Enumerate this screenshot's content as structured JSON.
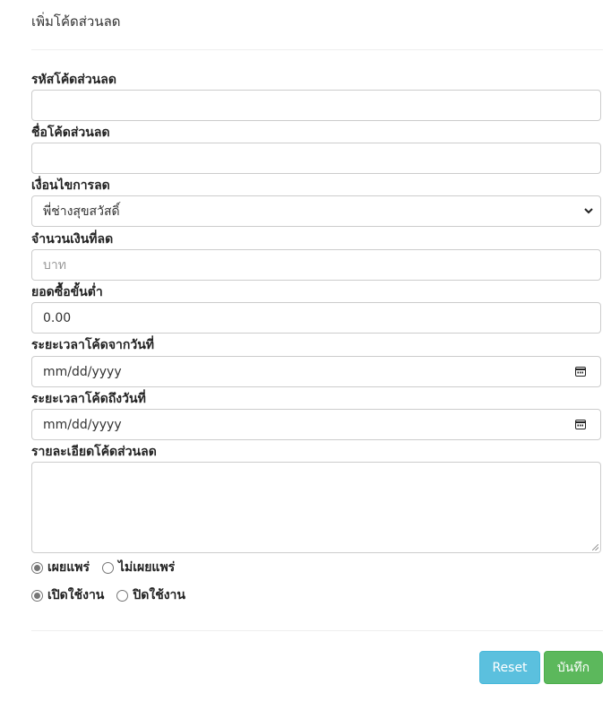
{
  "page": {
    "title": "เพิ่มโค้ดส่วนลด"
  },
  "form": {
    "code": {
      "label": "รหัสโค้ดส่วนลด",
      "value": ""
    },
    "name": {
      "label": "ชื่อโค้ดส่วนลด",
      "value": ""
    },
    "condition": {
      "label": "เงื่อนไขการลด",
      "selected": "พี่ช่างสุขสวัสดิ์"
    },
    "amount": {
      "label": "จำนวนเงินที่ลด",
      "placeholder": "บาท"
    },
    "min_purchase": {
      "label": "ยอดซื้อขั้นต่ำ",
      "value": "0.00"
    },
    "start_date": {
      "label": "ระยะเวลาโค้ดจากวันที่",
      "placeholder": "mm/dd/yyyy"
    },
    "end_date": {
      "label": "ระยะเวลาโค้ดถึงวันที่",
      "placeholder": "mm/dd/yyyy"
    },
    "details": {
      "label": "รายละเอียดโค้ดส่วนลด",
      "value": ""
    },
    "publish": {
      "options": [
        "เผยแพร่",
        "ไม่เผยแพร่"
      ],
      "selected_index": 0
    },
    "status": {
      "options": [
        "เปิดใช้งาน",
        "ปิดใช้งาน"
      ],
      "selected_index": 0
    }
  },
  "actions": {
    "reset_label": "Reset",
    "save_label": "บันทึก"
  },
  "colors": {
    "reset_button": "#5bc0de",
    "save_button": "#5cb85c",
    "input_border": "#cccccc"
  },
  "icons": {
    "select": "chevron-down-icon",
    "date": "calendar-icon"
  }
}
